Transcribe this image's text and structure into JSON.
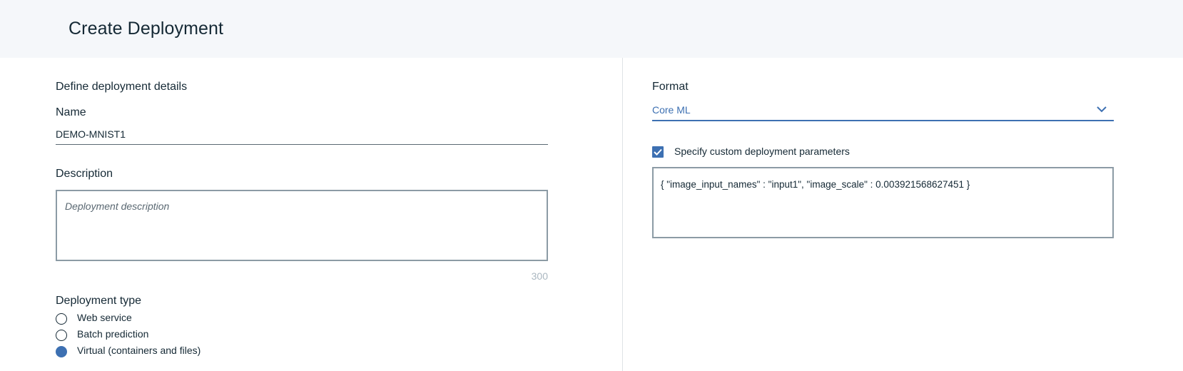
{
  "header": {
    "title": "Create Deployment"
  },
  "left": {
    "section_title": "Define deployment details",
    "name": {
      "label": "Name",
      "value": "DEMO-MNIST1"
    },
    "description": {
      "label": "Description",
      "placeholder": "Deployment description",
      "max_length": "300"
    },
    "deployment_type": {
      "label": "Deployment type",
      "options": [
        {
          "label": "Web service",
          "selected": false
        },
        {
          "label": "Batch prediction",
          "selected": false
        },
        {
          "label": "Virtual (containers and files)",
          "selected": true
        }
      ]
    }
  },
  "right": {
    "format": {
      "label": "Format",
      "value": "Core ML",
      "icon": "chevron-down-icon"
    },
    "custom_params": {
      "checked": true,
      "label": "Specify custom deployment parameters",
      "value": "{ \"image_input_names\" : \"input1\", \"image_scale\" : 0.003921568627451 }"
    }
  },
  "colors": {
    "accent": "#3d70b2",
    "text": "#152935",
    "header_bg": "#f5f7fa",
    "border": "#8c9ba5"
  }
}
